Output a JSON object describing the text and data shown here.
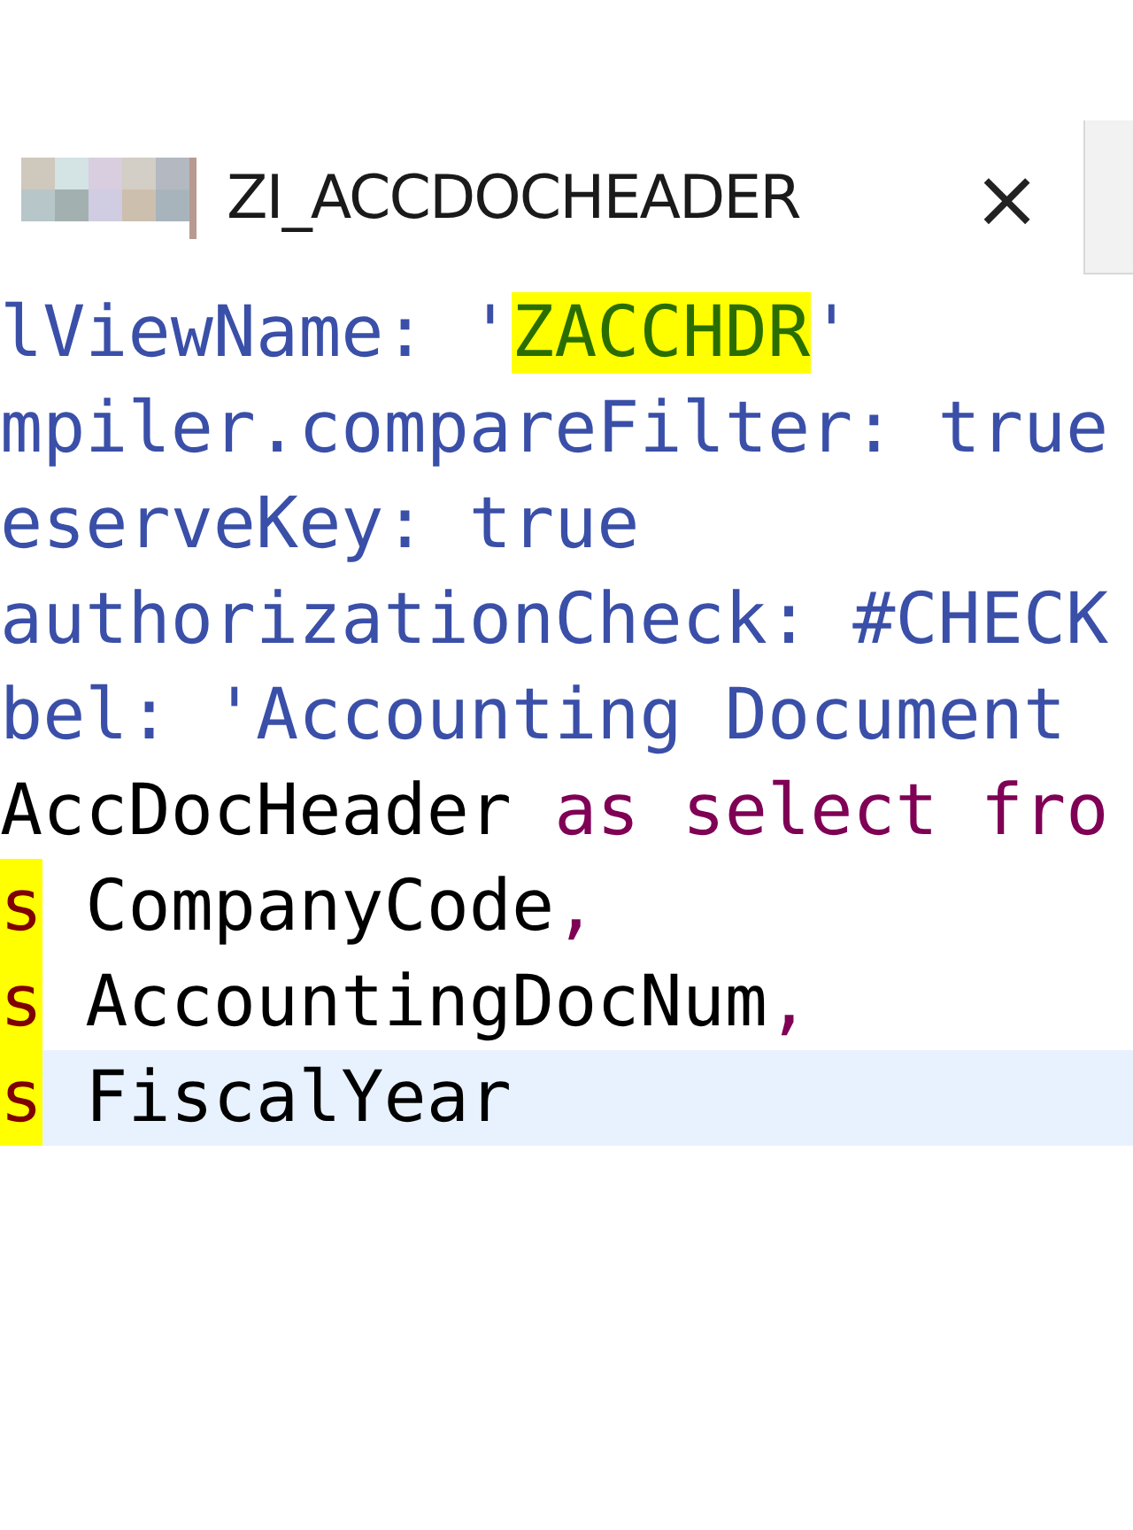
{
  "tab": {
    "title": "ZI_ACCDOCHEADER",
    "close": "×",
    "selected": true
  },
  "lines": [
    {
      "current": false,
      "tokens": [
        {
          "text": "lViewName: '",
          "kind": "annotation"
        },
        {
          "text": "ZACCHDR",
          "kind": "marked_string"
        },
        {
          "text": "'",
          "kind": "annotation"
        }
      ]
    },
    {
      "current": false,
      "tokens": [
        {
          "text": "mpiler.compareFilter: true",
          "kind": "annotation"
        }
      ]
    },
    {
      "current": false,
      "tokens": [
        {
          "text": "eserveKey: true",
          "kind": "annotation"
        }
      ]
    },
    {
      "current": false,
      "tokens": [
        {
          "text": "authorizationCheck: #CHECK",
          "kind": "annotation"
        }
      ]
    },
    {
      "current": false,
      "tokens": [
        {
          "text": "bel: 'Accounting Document ",
          "kind": "annotation"
        }
      ]
    },
    {
      "current": false,
      "tokens": [
        {
          "text": "AccDocHeader ",
          "kind": "identifier"
        },
        {
          "text": "as select fro",
          "kind": "keyword"
        }
      ]
    },
    {
      "current": false,
      "tokens": [
        {
          "text": "s",
          "kind": "marked_keyword"
        },
        {
          "text": " CompanyCode",
          "kind": "identifier"
        },
        {
          "text": ",",
          "kind": "keyword"
        }
      ]
    },
    {
      "current": false,
      "tokens": [
        {
          "text": "s",
          "kind": "marked_keyword"
        },
        {
          "text": " AccountingDocNum",
          "kind": "identifier"
        },
        {
          "text": ",",
          "kind": "keyword"
        }
      ]
    },
    {
      "current": true,
      "tokens": [
        {
          "text": "s",
          "kind": "marked_keyword"
        },
        {
          "text": " FiscalYear",
          "kind": "identifier"
        }
      ]
    }
  ]
}
